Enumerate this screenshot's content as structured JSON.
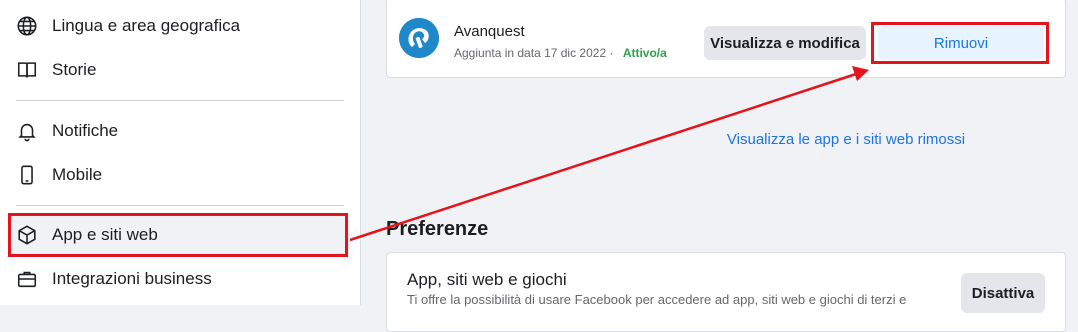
{
  "sidebar": {
    "items": [
      {
        "label": "Lingua e area geografica",
        "icon": "globe-icon"
      },
      {
        "label": "Storie",
        "icon": "book-icon"
      },
      {
        "label": "Notifiche",
        "icon": "bell-icon"
      },
      {
        "label": "Mobile",
        "icon": "phone-icon"
      },
      {
        "label": "App e siti web",
        "icon": "cube-icon"
      },
      {
        "label": "Integrazioni business",
        "icon": "briefcase-icon"
      }
    ]
  },
  "app_card": {
    "name": "Avanquest",
    "added": "Aggiunta in data 17 dic 2022",
    "separator": "·",
    "status": "Attivo/a",
    "view_button": "Visualizza e modifica",
    "remove_button": "Rimuovi"
  },
  "removed_link": "Visualizza le app e i siti web rimossi",
  "preferences": {
    "title": "Preferenze",
    "card_title": "App, siti web e giochi",
    "card_desc": "Ti offre la possibilità di usare Facebook per accedere ad app, siti web e giochi di terzi e",
    "disable_button": "Disattiva"
  },
  "colors": {
    "highlight": "#e3141b",
    "link": "#1b74e4",
    "status": "#31a24c"
  }
}
